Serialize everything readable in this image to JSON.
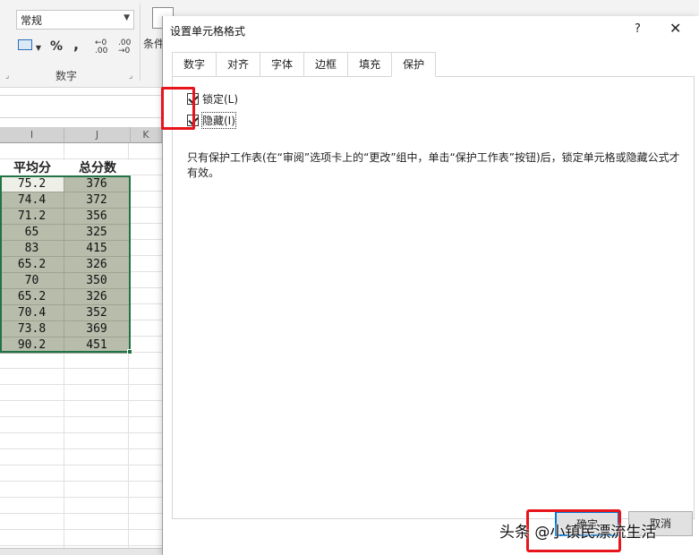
{
  "ribbon": {
    "number_format": "常规",
    "percent_symbol": "%",
    "comma_symbol": ",",
    "increase_decimal": "←0 .00",
    "decrease_decimal": ".00 →0",
    "conditional_partial": "条件",
    "group_label": "数字"
  },
  "sheet": {
    "headers": [
      "平均分",
      "总分数"
    ],
    "rows": [
      [
        "75.2",
        "376"
      ],
      [
        "74.4",
        "372"
      ],
      [
        "71.2",
        "356"
      ],
      [
        "65",
        "325"
      ],
      [
        "83",
        "415"
      ],
      [
        "65.2",
        "326"
      ],
      [
        "70",
        "350"
      ],
      [
        "65.2",
        "326"
      ],
      [
        "70.4",
        "352"
      ],
      [
        "73.8",
        "369"
      ],
      [
        "90.2",
        "451"
      ]
    ],
    "selection_color": "#217346",
    "cell_fill": "#b7bcab"
  },
  "dialog": {
    "title": "设置单元格格式",
    "help": "?",
    "close": "✕",
    "tabs": [
      "数字",
      "对齐",
      "字体",
      "边框",
      "填充",
      "保护"
    ],
    "active_tab": "保护",
    "lock_label": "锁定(L)",
    "lock_checked": true,
    "hide_label": "隐藏(I)",
    "hide_checked": true,
    "hint": "只有保护工作表(在“审阅”选项卡上的“更改”组中，单击“保护工作表”按钮)后，锁定单元格或隐藏公式才有效。",
    "ok_label": "确定",
    "cancel_label": "取消"
  },
  "watermark": "头条 @小镇民漂流生活",
  "highlight_color": "#e8141b"
}
